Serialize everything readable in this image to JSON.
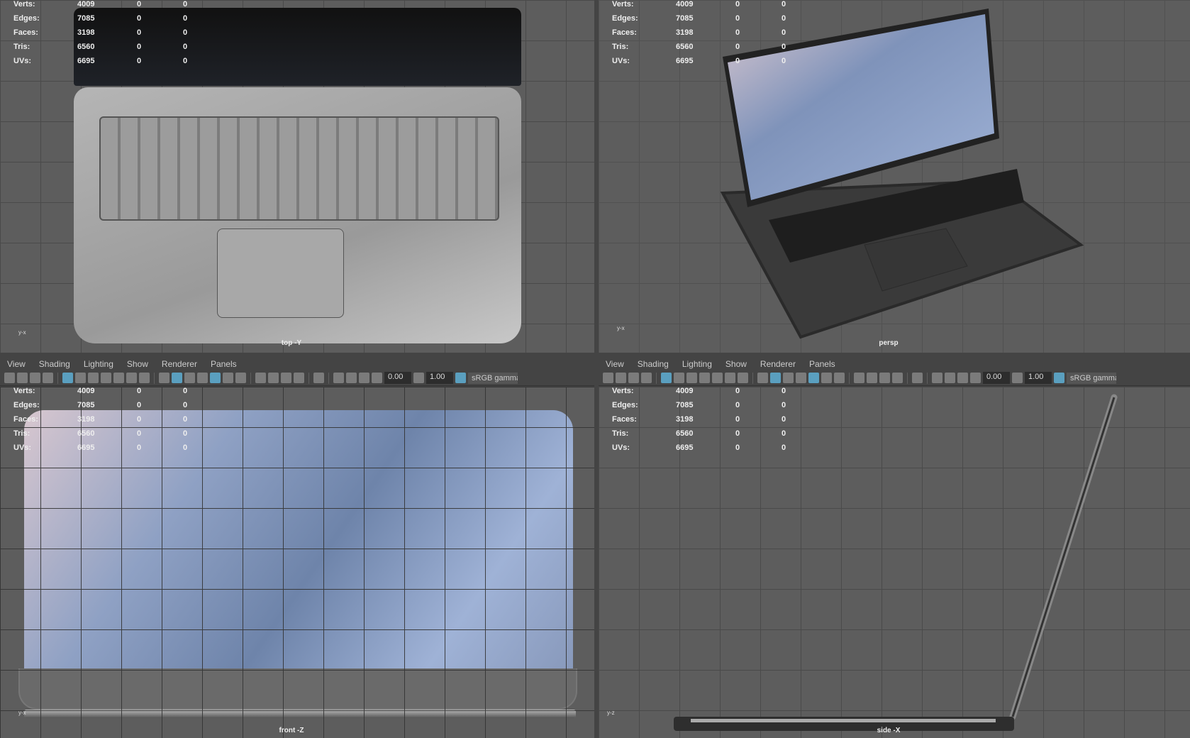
{
  "menu": [
    "View",
    "Shading",
    "Lighting",
    "Show",
    "Renderer",
    "Panels"
  ],
  "toolbar": {
    "exposure": "0.00",
    "gamma": "1.00",
    "color_space": "sRGB gamma",
    "icons": [
      "camera-icon",
      "camera-attr-icon",
      "bookmark-icon",
      "image-plane-icon",
      "sep",
      "grid-icon",
      "film-gate-icon",
      "resolution-gate-icon",
      "gate-mask-icon",
      "field-chart-icon",
      "safe-action-icon",
      "safe-title-icon",
      "sep",
      "wireframe-icon",
      "smooth-shade-icon",
      "default-material-icon",
      "wireframe-on-shaded-icon",
      "xray-icon",
      "lights-icon",
      "shadows-icon",
      "sep",
      "ambient-occlusion-icon",
      "motion-blur-icon",
      "antialias-icon",
      "depth-of-field-icon",
      "sep",
      "isolate-select-icon",
      "sep",
      "xray-joints-icon",
      "xray-active-icon",
      "backface-icon"
    ]
  },
  "stats_labels": [
    "Verts:",
    "Edges:",
    "Faces:",
    "Tris:",
    "UVs:"
  ],
  "stats_values": [
    "4009",
    "7085",
    "3198",
    "6560",
    "6695"
  ],
  "stats_zero": "0",
  "views": {
    "top": "top -Y",
    "persp": "persp",
    "front": "front -Z",
    "side": "side -X"
  }
}
